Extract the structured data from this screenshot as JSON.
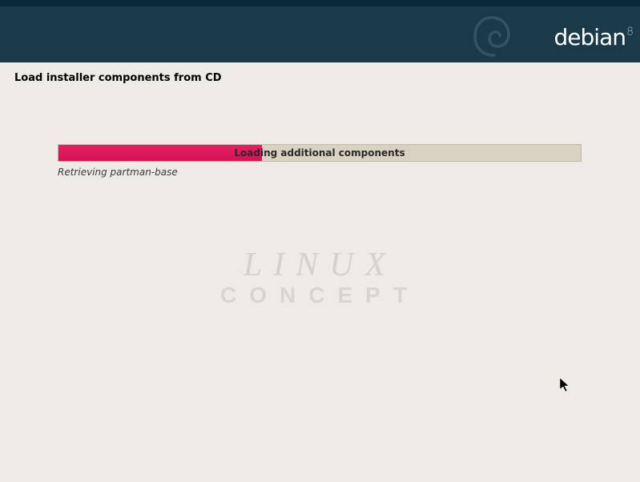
{
  "header": {
    "brand": "debian",
    "version": "8"
  },
  "page": {
    "title": "Load installer components from CD"
  },
  "progress": {
    "label": "Loading additional components",
    "percent": 39,
    "status": "Retrieving partman-base"
  },
  "watermark": {
    "line1": "LINUX",
    "line2": "CONCEPT"
  }
}
